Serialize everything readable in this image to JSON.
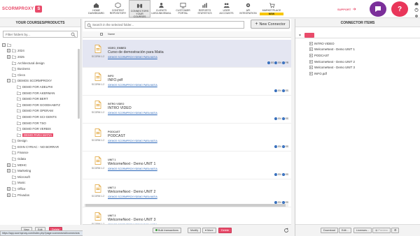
{
  "brand": {
    "logo_text": "SCORMPROXY",
    "accent": "#e94b6a"
  },
  "nav": [
    {
      "line1": "HOME",
      "line2": "DASHBOARD",
      "icon": "home-icon"
    },
    {
      "line1": "CONTENT",
      "line2": "REPOSITORY",
      "icon": "cube-icon"
    },
    {
      "line1": "CONNECTORS",
      "line2": "YOUR COURSES",
      "icon": "connectors-icon",
      "active": true
    },
    {
      "line1": "CLIENTS",
      "line2": "LMS/LINK/EMAIL",
      "icon": "clients-icon"
    },
    {
      "line1": "CUSTOMER",
      "line2": "PORTAL",
      "icon": "portal-icon"
    },
    {
      "line1": "REPORTS",
      "line2": "STATISTICS",
      "icon": "chart-icon"
    },
    {
      "line1": "USER",
      "line2": "ACCOUNTS",
      "icon": "users-icon"
    },
    {
      "line1": "API",
      "line2": "INTEGRATION",
      "icon": "gear-icon"
    },
    {
      "line1": "MARKETPLACE",
      "line2": "NEW",
      "icon": "cart-icon"
    }
  ],
  "support": {
    "label": "SUPPORT"
  },
  "left": {
    "title": "YOUR COURSES/PRODUCTS",
    "filter_placeholder": "Filter folders by...",
    "tree": [
      {
        "label": "",
        "level": 0,
        "expander": "−"
      },
      {
        "label": "2024",
        "level": 1,
        "expander": "+"
      },
      {
        "label": "2025",
        "level": 1,
        "expander": "+"
      },
      {
        "label": "Architectural design",
        "level": 1
      },
      {
        "label": "Business",
        "level": 1
      },
      {
        "label": "Clecs",
        "level": 1
      },
      {
        "label": "DEMOS SCORMPROXY",
        "level": 1,
        "expander": "−"
      },
      {
        "label": "DEMO FOR ADELPHI",
        "level": 2
      },
      {
        "label": "DEMO FOR AKERMAN",
        "level": 2
      },
      {
        "label": "DEMO FOR BERT",
        "level": 2
      },
      {
        "label": "DEMO FOR GOODHABITZ",
        "level": 2
      },
      {
        "label": "DEMO FOR OPERAM",
        "level": 2
      },
      {
        "label": "DEMO FOR SCI-GENTS",
        "level": 2
      },
      {
        "label": "DEMO FOR TSO",
        "level": 2
      },
      {
        "label": "DEMO FOR VERBIX",
        "level": 2
      },
      {
        "label": "DEMO PARA MATIA",
        "level": 2,
        "selected": true
      },
      {
        "label": "Design",
        "level": 1
      },
      {
        "label": "EOIN CYRIAC - NO BORRAR",
        "level": 1
      },
      {
        "label": "Finance",
        "level": 1
      },
      {
        "label": "Gdata",
        "level": 1
      },
      {
        "label": "MDHC",
        "level": 1,
        "expander": "+"
      },
      {
        "label": "Marketing",
        "level": 1,
        "expander": "+"
      },
      {
        "label": "Microsoft",
        "level": 1
      },
      {
        "label": "Music",
        "level": 1
      },
      {
        "label": "Office",
        "level": 1,
        "expander": "+"
      },
      {
        "label": "Privados",
        "level": 1,
        "expander": "+"
      }
    ],
    "status_url": "https://app.scormproxy.com/index.php?page=connectors#/connectors"
  },
  "center": {
    "search_placeholder": "Search in the selected folder...",
    "new_connector_label": "New Connector",
    "column_name": "Name",
    "rows": [
      {
        "type": "VIDEO_EMBED",
        "title": "Curso de demostración para Matia",
        "path": "/DEMOS SCORMPROXY/DEMO PARA MATIA",
        "icon_label": "SCORM 1.2",
        "tags": [
          "ES",
          "EN",
          "FR"
        ],
        "selected": true
      },
      {
        "type": "INFO",
        "title": "INFO.pdf",
        "path": "/DEMOS SCORMPROXY/DEMO PARA MATIA",
        "icon_label": "SCORM 1.2",
        "tags": [
          "EN",
          "ES"
        ]
      },
      {
        "type": "INTRO VIDEO",
        "title": "INTRO VIDEO",
        "path": "/DEMOS SCORMPROXY/DEMO PARA MATIA",
        "icon_label": "SCORM 1.2",
        "tags": [
          "EN",
          "ES"
        ]
      },
      {
        "type": "PODCAST",
        "title": "PODCAST",
        "path": "/DEMOS SCORMPROXY/DEMO PARA MATIA",
        "icon_label": "SCORM 1.2",
        "tags": [
          "EN",
          "ES"
        ]
      },
      {
        "type": "UNIT 1",
        "title": "WelcomeNext - Demo UNIT 1",
        "path": "/DEMOS SCORMPROXY/DEMO PARA MATIA",
        "icon_label": "SCORM 1.2",
        "tags": [
          "EN",
          "ES"
        ]
      },
      {
        "type": "UNIT 2",
        "title": "WelcomeNext - Demo UNIT 2",
        "path": "/DEMOS SCORMPROXY/DEMO PARA MATIA",
        "icon_label": "SCORM 1.2",
        "tags": [
          "EN",
          "ES"
        ]
      },
      {
        "type": "UNIT 3",
        "title": "WelcomeNext - Demo UNIT 3",
        "path": "/DEMOS SCORMPROXY/DEMO PARA MATIA",
        "icon_label": "SCORM 1.2",
        "tags": [
          "EN",
          "ES"
        ]
      }
    ],
    "bottom": {
      "bulk": "Bulk transactions",
      "modify": "Modify",
      "more": "More",
      "delete": "Delete"
    }
  },
  "right": {
    "title": "CONNECTOR ITEMS",
    "items": [
      "INTRO VIDEO",
      "WelcomeNext - Demo UNIT 1",
      "PODCAST",
      "WelcomeNext - Demo UNIT 2",
      "WelcomeNext - Demo UNIT 3",
      "INFO.pdf"
    ],
    "bottom": {
      "download": "Download",
      "edit": "Edit...",
      "licenses": "Licenses...",
      "preview": "Preview"
    }
  },
  "left_bottom": {
    "new": "New",
    "edit": "Edit",
    "delete": "Delete"
  }
}
